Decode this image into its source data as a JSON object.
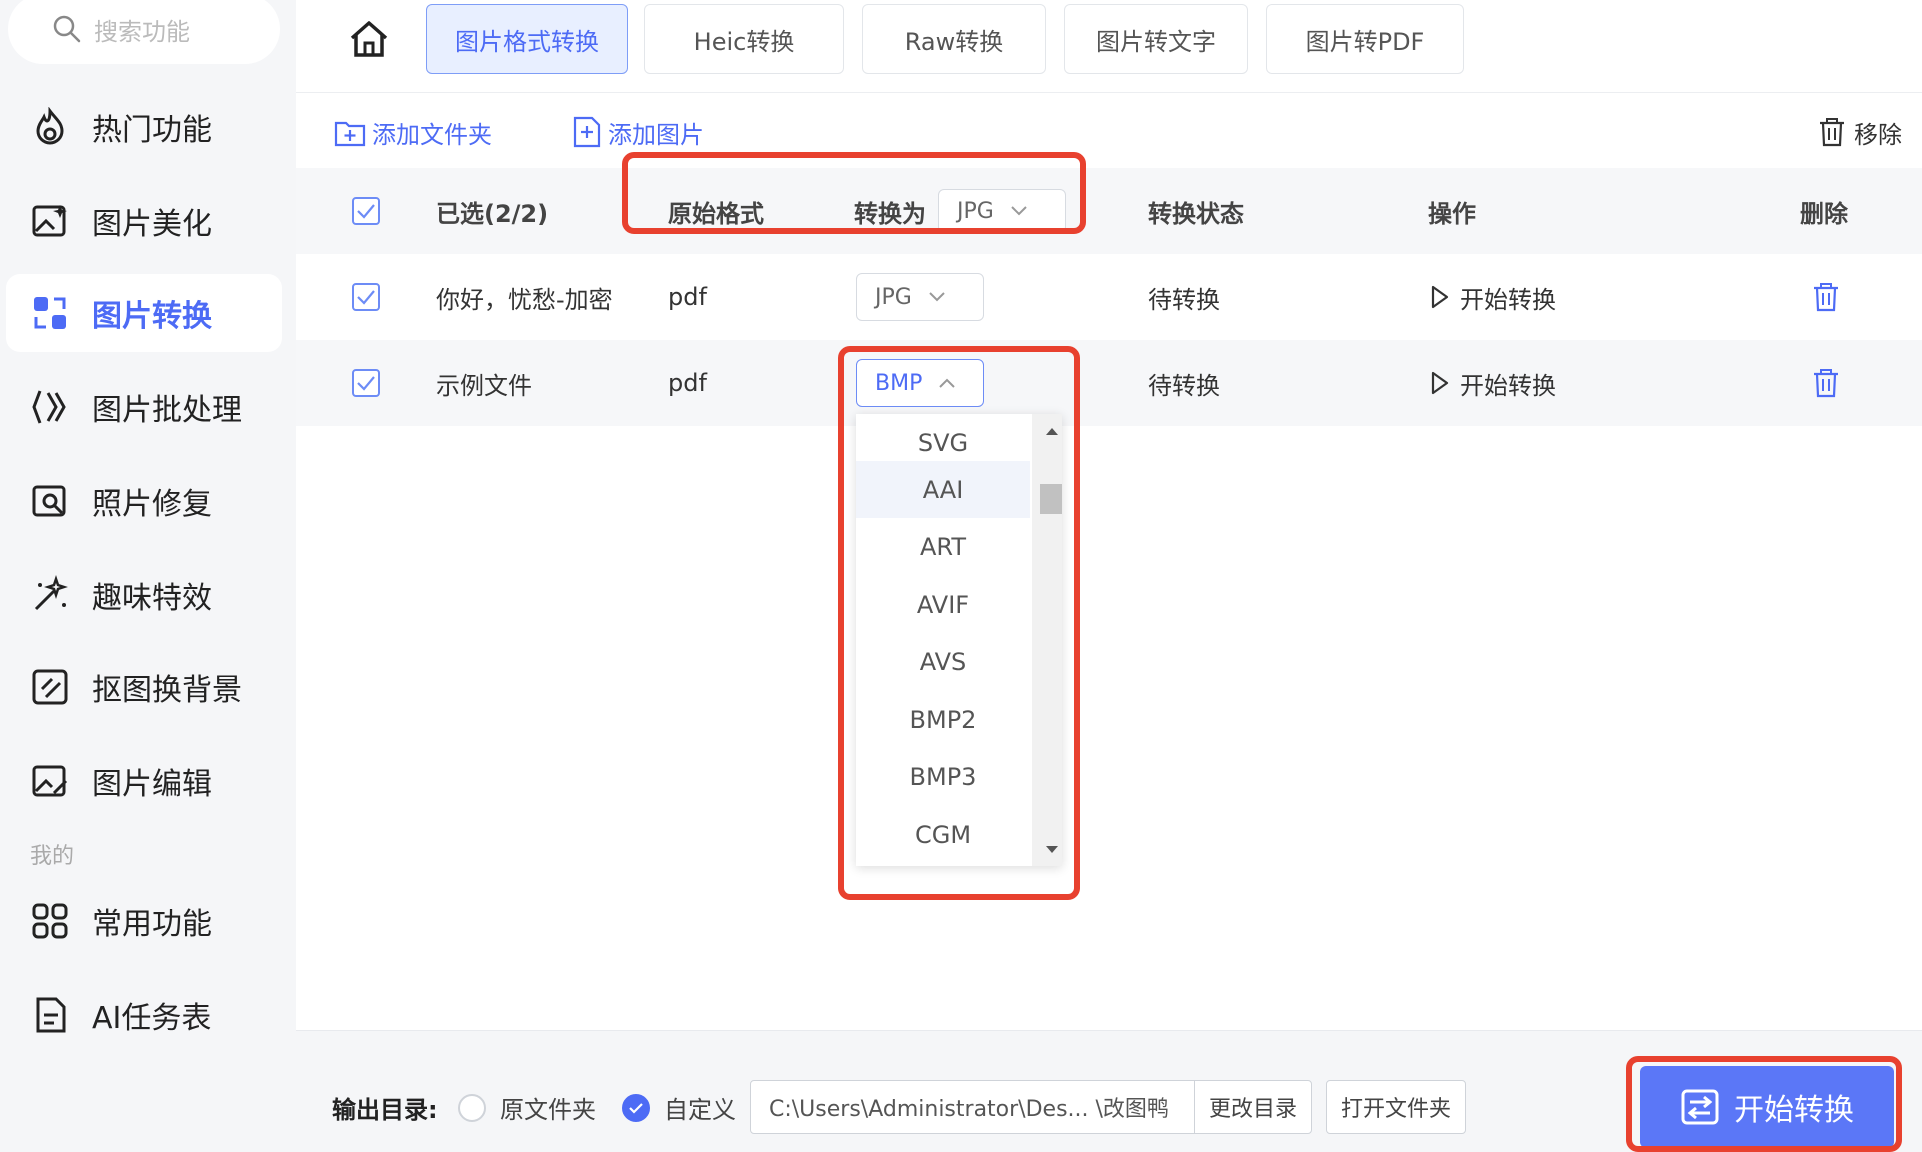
{
  "search": {
    "placeholder": "搜索功能"
  },
  "sidebar": {
    "items": [
      {
        "label": "热门功能",
        "icon": "flame-icon"
      },
      {
        "label": "图片美化",
        "icon": "image-sparkle-icon"
      },
      {
        "label": "图片转换",
        "icon": "convert-icon",
        "active": true
      },
      {
        "label": "图片批处理",
        "icon": "batch-icon"
      },
      {
        "label": "照片修复",
        "icon": "photo-repair-icon"
      },
      {
        "label": "趣味特效",
        "icon": "magic-wand-icon"
      },
      {
        "label": "抠图换背景",
        "icon": "cutout-icon"
      },
      {
        "label": "图片编辑",
        "icon": "image-edit-icon"
      }
    ],
    "section_label": "我的",
    "my_items": [
      {
        "label": "常用功能",
        "icon": "grid-icon"
      },
      {
        "label": "AI任务表",
        "icon": "document-icon"
      }
    ]
  },
  "tabs": [
    {
      "label": "图片格式转换",
      "active": true
    },
    {
      "label": "Heic转换"
    },
    {
      "label": "Raw转换"
    },
    {
      "label": "图片转文字"
    },
    {
      "label": "图片转PDF"
    }
  ],
  "toolbar": {
    "add_folder": "添加文件夹",
    "add_image": "添加图片",
    "remove": "移除"
  },
  "table": {
    "header": {
      "selected": "已选(2/2)",
      "original_format": "原始格式",
      "convert_to": "转换为",
      "convert_to_value": "JPG",
      "status": "转换状态",
      "action": "操作",
      "delete": "删除"
    },
    "rows": [
      {
        "name": "你好，忧愁-加密",
        "format": "pdf",
        "target": "JPG",
        "status": "待转换",
        "action": "开始转换"
      },
      {
        "name": "示例文件",
        "format": "pdf",
        "target": "BMP",
        "status": "待转换",
        "action": "开始转换"
      }
    ]
  },
  "dropdown": {
    "options": [
      "SVG",
      "AAI",
      "ART",
      "AVIF",
      "AVS",
      "BMP2",
      "BMP3",
      "CGM"
    ],
    "hovered": "AAI"
  },
  "footer": {
    "output_label": "输出目录:",
    "option_original": "原文件夹",
    "option_custom": "自定义",
    "path": "C:\\Users\\Administrator\\Des... \\改图鸭",
    "change_dir": "更改目录",
    "open_folder": "打开文件夹",
    "start": "开始转换"
  },
  "colors": {
    "accent": "#4d6bf5",
    "annotation": "#e8412f",
    "button": "#5b77f7"
  }
}
